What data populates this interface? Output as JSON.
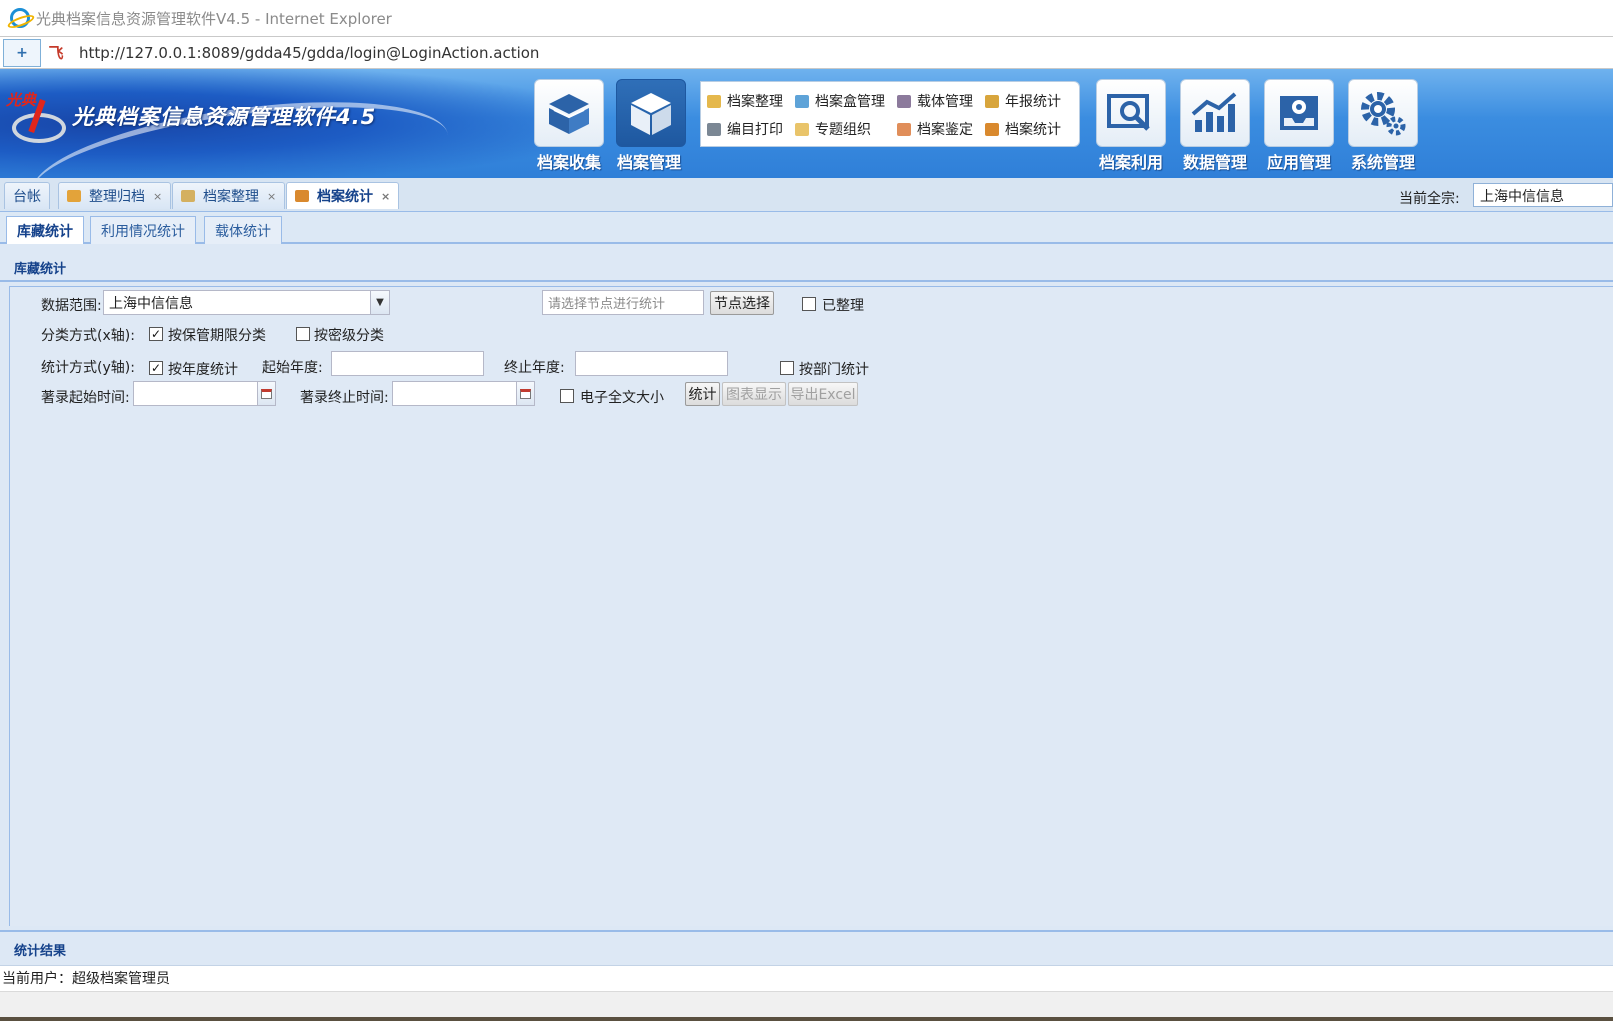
{
  "browser": {
    "window_title": "光典档案信息资源管理软件V4.5 - Internet Explorer",
    "url": "http://127.0.0.1:8089/gdda45/gdda/login@LoginAction.action",
    "site_icon_glyph": "飞"
  },
  "app": {
    "logo_text": "光典",
    "name": "光典档案信息资源管理软件4.5"
  },
  "main_menu": [
    {
      "label": "档案收集",
      "icon": "open-box-icon",
      "active": false
    },
    {
      "label": "档案管理",
      "icon": "box-icon",
      "active": true
    },
    {
      "label": "档案利用",
      "icon": "search-window-icon",
      "active": false
    },
    {
      "label": "数据管理",
      "icon": "chart-icon",
      "active": false
    },
    {
      "label": "应用管理",
      "icon": "inbox-gear-icon",
      "active": false
    },
    {
      "label": "系统管理",
      "icon": "gears-icon",
      "active": false
    }
  ],
  "submenu": [
    {
      "label": "档案整理",
      "icon": "folder-icon"
    },
    {
      "label": "档案盒管理",
      "icon": "boxes-icon"
    },
    {
      "label": "载体管理",
      "icon": "media-icon"
    },
    {
      "label": "年报统计",
      "icon": "books-icon"
    },
    {
      "label": "编目打印",
      "icon": "printer-icon"
    },
    {
      "label": "专题组织",
      "icon": "topic-icon"
    },
    {
      "label": "档案鉴定",
      "icon": "appraise-icon"
    },
    {
      "label": "档案统计",
      "icon": "stats-icon"
    }
  ],
  "module_tabs": [
    {
      "label": "台帐",
      "closable": false,
      "active": false
    },
    {
      "label": "整理归档",
      "closable": true,
      "active": false
    },
    {
      "label": "档案整理",
      "closable": true,
      "active": false
    },
    {
      "label": "档案统计",
      "closable": true,
      "active": true
    }
  ],
  "close_glyph": "×",
  "current_zong": {
    "label": "当前全宗:",
    "value": "上海中信信息"
  },
  "sub_tabs": [
    {
      "label": "库藏统计",
      "active": true
    },
    {
      "label": "利用情况统计",
      "active": false
    },
    {
      "label": "载体统计",
      "active": false
    }
  ],
  "panel_title": "库藏统计",
  "form": {
    "data_scope_label": "数据范围:",
    "data_scope_value": "上海中信信息",
    "node_placeholder": "请选择节点进行统计",
    "node_select_button": "节点选择",
    "organized_label": "已整理",
    "organized_checked": false,
    "x_axis_label": "分类方式(x轴):",
    "by_retention_label": "按保管期限分类",
    "by_retention_checked": true,
    "by_secret_label": "按密级分类",
    "by_secret_checked": false,
    "y_axis_label": "统计方式(y轴):",
    "by_year_label": "按年度统计",
    "by_year_checked": true,
    "start_year_label": "起始年度:",
    "start_year_value": "",
    "end_year_label": "终止年度:",
    "end_year_value": "",
    "by_dept_label": "按部门统计",
    "by_dept_checked": false,
    "record_start_label": "著录起始时间:",
    "record_start_value": "",
    "record_end_label": "著录终止时间:",
    "record_end_value": "",
    "e_fulltext_label": "电子全文大小",
    "e_fulltext_checked": false,
    "stat_button": "统计",
    "chart_button": "图表显示",
    "export_button": "导出Excel",
    "check_glyph": "✓",
    "combo_glyph": "▼"
  },
  "result_title": "统计结果",
  "status": {
    "current_user": "当前用户：超级档案管理员"
  }
}
